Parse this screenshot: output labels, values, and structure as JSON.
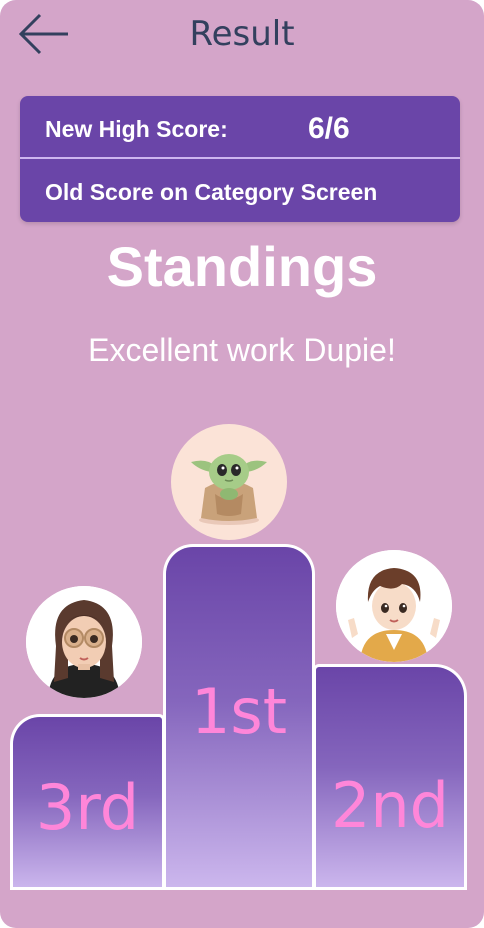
{
  "header": {
    "title": "Result",
    "back_icon": "arrow-left-icon"
  },
  "score_card": {
    "high_score_label": "New High Score:",
    "high_score_value": "6/6",
    "old_score_label": "Old Score on Category Screen"
  },
  "standings": {
    "heading": "Standings",
    "message": "Excellent work Dupie!"
  },
  "podium": [
    {
      "rank": "1st",
      "avatar": "baby-yoda-avatar"
    },
    {
      "rank": "2nd",
      "avatar": "boy-avatar"
    },
    {
      "rank": "3rd",
      "avatar": "girl-avatar"
    }
  ],
  "colors": {
    "background": "#d4a5c9",
    "card": "#6a45a8",
    "rank_text": "#ff86d9",
    "title_text": "#33405e"
  }
}
